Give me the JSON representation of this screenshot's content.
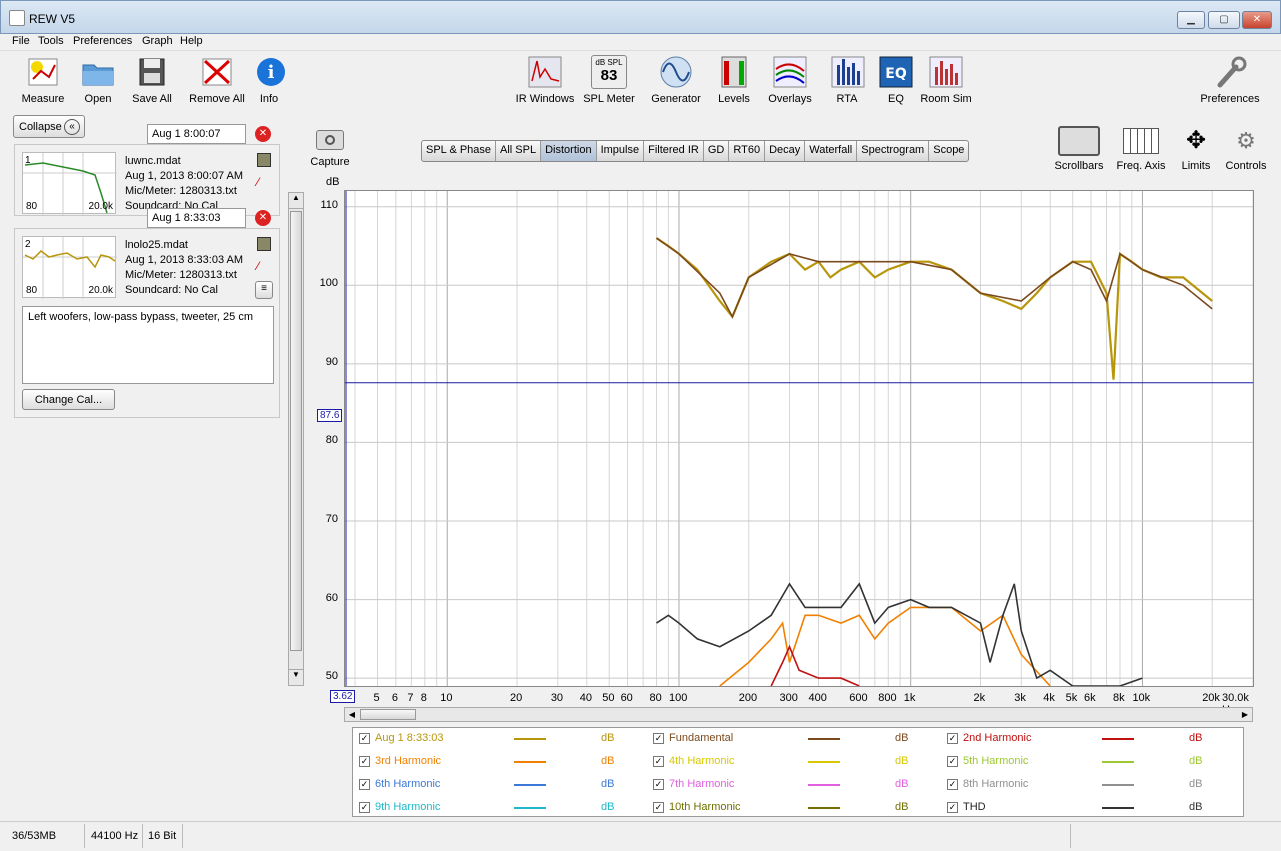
{
  "window": {
    "title": "REW V5"
  },
  "menu": [
    "File",
    "Tools",
    "Preferences",
    "Graph",
    "Help"
  ],
  "toolbar_left": [
    {
      "label": "Measure",
      "icon": "measure-icon"
    },
    {
      "label": "Open",
      "icon": "folder-icon"
    },
    {
      "label": "Save All",
      "icon": "save-all-icon"
    },
    {
      "label": "Remove All",
      "icon": "remove-all-icon"
    },
    {
      "label": "Info",
      "icon": "info-icon"
    }
  ],
  "toolbar_center": [
    {
      "label": "IR Windows",
      "icon": "ir-windows-icon"
    },
    {
      "label": "SPL Meter",
      "icon": "spl-meter-icon",
      "badge_top": "dB SPL",
      "badge_value": "83"
    },
    {
      "label": "Generator",
      "icon": "generator-icon"
    },
    {
      "label": "Levels",
      "icon": "levels-icon"
    },
    {
      "label": "Overlays",
      "icon": "overlays-icon"
    },
    {
      "label": "RTA",
      "icon": "rta-icon"
    },
    {
      "label": "EQ",
      "icon": "eq-icon"
    },
    {
      "label": "Room Sim",
      "icon": "room-sim-icon"
    }
  ],
  "toolbar_right": {
    "label": "Preferences",
    "icon": "wrench-icon"
  },
  "sidebar": {
    "collapse_label": "Collapse",
    "m1": {
      "name_field": "Aug 1 8:00:07",
      "index": "1",
      "file": "luwnc.mdat",
      "date": "Aug 1, 2013 8:00:07 AM",
      "mic": "Mic/Meter: 1280313.txt",
      "soundcard": "Soundcard: No Cal",
      "x_min": "80",
      "x_max": "20.0k"
    },
    "m2": {
      "name_field": "Aug 1 8:33:03",
      "index": "2",
      "file": "lnolo25.mdat",
      "date": "Aug 1, 2013 8:33:03 AM",
      "mic": "Mic/Meter: 1280313.txt",
      "soundcard": "Soundcard: No Cal",
      "x_min": "80",
      "x_max": "20.0k",
      "notes": "Left woofers, low-pass bypass, tweeter, 25 cm",
      "change_cal": "Change Cal..."
    }
  },
  "capture_label": "Capture",
  "tabs": [
    "SPL & Phase",
    "All SPL",
    "Distortion",
    "Impulse",
    "Filtered IR",
    "GD",
    "RT60",
    "Decay",
    "Waterfall",
    "Spectrogram",
    "Scope"
  ],
  "selected_tab": "Distortion",
  "graph_controls": [
    {
      "label": "Scrollbars",
      "icon": "scrollbars-icon"
    },
    {
      "label": "Freq. Axis",
      "icon": "freq-axis-icon"
    },
    {
      "label": "Limits",
      "icon": "limits-icon"
    },
    {
      "label": "Controls",
      "icon": "gear-icon"
    }
  ],
  "chart_data": {
    "type": "line",
    "ylabel": "dB",
    "xlabel": "Hz",
    "ylim": [
      49,
      112
    ],
    "xlim": [
      3.62,
      30000
    ],
    "x_scale": "log",
    "yticks": [
      "110",
      "100",
      "90",
      "80",
      "70",
      "60",
      "50"
    ],
    "xticks": [
      "5",
      "6",
      "7",
      "8",
      "10",
      "20",
      "30",
      "40",
      "50",
      "60",
      "80",
      "100",
      "200",
      "300",
      "400",
      "600",
      "800",
      "1k",
      "2k",
      "3k",
      "4k",
      "5k",
      "6k",
      "8k",
      "10k",
      "20k",
      "30.0k Hz"
    ],
    "cursor": {
      "y": "87.6",
      "x": "3.62"
    },
    "series": [
      {
        "name": "Aug 1 8:33:03",
        "color": "#b8960c",
        "points": [
          [
            80,
            106
          ],
          [
            90,
            105
          ],
          [
            100,
            104
          ],
          [
            120,
            102
          ],
          [
            150,
            98
          ],
          [
            170,
            96
          ],
          [
            200,
            101
          ],
          [
            250,
            103
          ],
          [
            300,
            104
          ],
          [
            350,
            102
          ],
          [
            400,
            103
          ],
          [
            450,
            101
          ],
          [
            500,
            102
          ],
          [
            600,
            103
          ],
          [
            700,
            101
          ],
          [
            800,
            102
          ],
          [
            1000,
            103
          ],
          [
            1200,
            103
          ],
          [
            1500,
            102
          ],
          [
            2000,
            99
          ],
          [
            2500,
            98
          ],
          [
            3000,
            97
          ],
          [
            3500,
            99
          ],
          [
            4000,
            101
          ],
          [
            5000,
            103
          ],
          [
            6000,
            103
          ],
          [
            7000,
            99
          ],
          [
            7500,
            88
          ],
          [
            8000,
            104
          ],
          [
            9000,
            103
          ],
          [
            10000,
            102
          ],
          [
            12000,
            101
          ],
          [
            15000,
            101
          ],
          [
            20000,
            98
          ]
        ]
      },
      {
        "name": "Fundamental",
        "color": "#7b4a1e",
        "points": [
          [
            80,
            106
          ],
          [
            100,
            104
          ],
          [
            150,
            99
          ],
          [
            170,
            96
          ],
          [
            200,
            101
          ],
          [
            300,
            104
          ],
          [
            400,
            103
          ],
          [
            600,
            103
          ],
          [
            1000,
            103
          ],
          [
            1500,
            102
          ],
          [
            2000,
            99
          ],
          [
            3000,
            98
          ],
          [
            4000,
            101
          ],
          [
            5000,
            103
          ],
          [
            6000,
            102
          ],
          [
            7000,
            98
          ],
          [
            8000,
            104
          ],
          [
            10000,
            102
          ],
          [
            15000,
            100
          ],
          [
            20000,
            97
          ]
        ]
      },
      {
        "name": "2nd Harmonic",
        "color": "#c01010",
        "points": [
          [
            250,
            49
          ],
          [
            280,
            52
          ],
          [
            300,
            54
          ],
          [
            330,
            51
          ],
          [
            400,
            50
          ],
          [
            500,
            50
          ],
          [
            600,
            49
          ]
        ]
      },
      {
        "name": "3rd Harmonic",
        "color": "#f08000",
        "points": [
          [
            150,
            49
          ],
          [
            200,
            52
          ],
          [
            250,
            55
          ],
          [
            280,
            57
          ],
          [
            300,
            52
          ],
          [
            350,
            58
          ],
          [
            400,
            58
          ],
          [
            500,
            57
          ],
          [
            600,
            58
          ],
          [
            700,
            55
          ],
          [
            800,
            57
          ],
          [
            1000,
            59
          ],
          [
            1500,
            59
          ],
          [
            2000,
            56
          ],
          [
            2500,
            58
          ],
          [
            3000,
            53
          ],
          [
            4000,
            49
          ]
        ]
      },
      {
        "name": "4th Harmonic",
        "color": "#d8c800",
        "points": []
      },
      {
        "name": "5th Harmonic",
        "color": "#9cc830",
        "points": []
      },
      {
        "name": "6th Harmonic",
        "color": "#3c78d8",
        "points": []
      },
      {
        "name": "7th Harmonic",
        "color": "#e060e0",
        "points": []
      },
      {
        "name": "8th Harmonic",
        "color": "#909090",
        "points": []
      },
      {
        "name": "9th Harmonic",
        "color": "#20b8c8",
        "points": []
      },
      {
        "name": "10th Harmonic",
        "color": "#707000",
        "points": []
      },
      {
        "name": "THD",
        "color": "#333333",
        "points": [
          [
            80,
            57
          ],
          [
            90,
            58
          ],
          [
            100,
            57
          ],
          [
            120,
            55
          ],
          [
            150,
            54
          ],
          [
            200,
            56
          ],
          [
            250,
            58
          ],
          [
            300,
            62
          ],
          [
            350,
            59
          ],
          [
            400,
            59
          ],
          [
            500,
            59
          ],
          [
            600,
            62
          ],
          [
            700,
            57
          ],
          [
            800,
            59
          ],
          [
            1000,
            60
          ],
          [
            1200,
            59
          ],
          [
            1500,
            59
          ],
          [
            2000,
            57
          ],
          [
            2200,
            52
          ],
          [
            2500,
            58
          ],
          [
            2800,
            62
          ],
          [
            3000,
            56
          ],
          [
            3500,
            50
          ],
          [
            4000,
            51
          ],
          [
            5000,
            49
          ],
          [
            8000,
            49
          ],
          [
            10000,
            50
          ]
        ]
      }
    ]
  },
  "legend": [
    {
      "name": "Aug 1 8:33:03",
      "unit": "dB",
      "color": "#b8960c"
    },
    {
      "name": "Fundamental",
      "unit": "dB",
      "color": "#7b4a1e"
    },
    {
      "name": "2nd Harmonic",
      "unit": "dB",
      "color": "#c01010"
    },
    {
      "name": "3rd Harmonic",
      "unit": "dB",
      "color": "#f08000"
    },
    {
      "name": "4th Harmonic",
      "unit": "dB",
      "color": "#d8c800"
    },
    {
      "name": "5th Harmonic",
      "unit": "dB",
      "color": "#9cc830"
    },
    {
      "name": "6th Harmonic",
      "unit": "dB",
      "color": "#3c78d8"
    },
    {
      "name": "7th Harmonic",
      "unit": "dB",
      "color": "#e060e0"
    },
    {
      "name": "8th Harmonic",
      "unit": "dB",
      "color": "#909090"
    },
    {
      "name": "9th Harmonic",
      "unit": "dB",
      "color": "#20b8c8"
    },
    {
      "name": "10th Harmonic",
      "unit": "dB",
      "color": "#707000"
    },
    {
      "name": "THD",
      "unit": "dB",
      "color": "#333333"
    }
  ],
  "status": {
    "memory": "36/53MB",
    "rate": "44100 Hz",
    "bits": "16 Bit"
  }
}
